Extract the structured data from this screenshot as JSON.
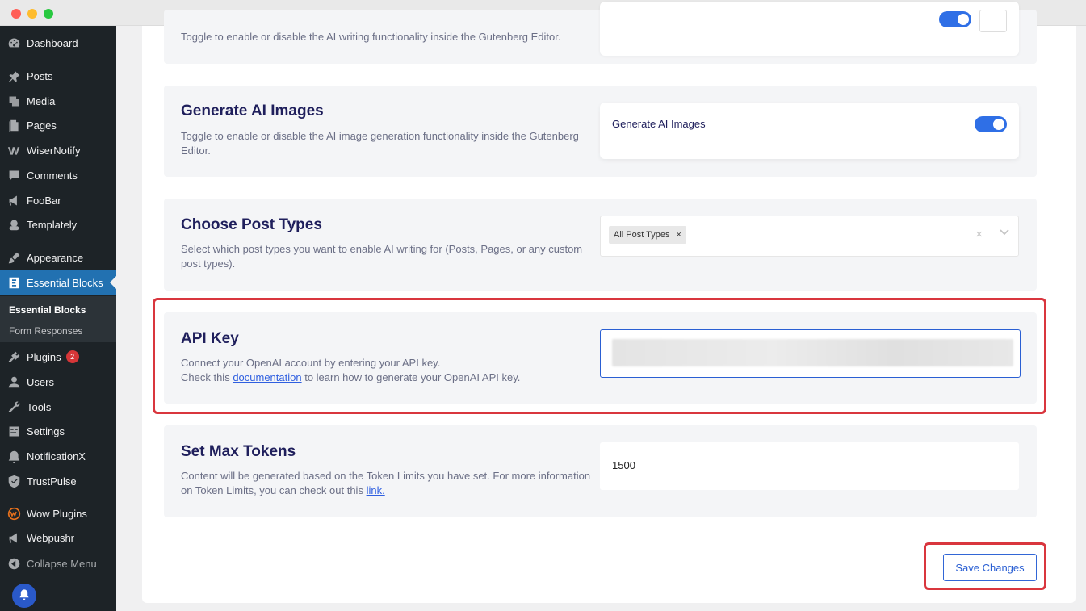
{
  "sidebar": {
    "items": [
      {
        "label": "Dashboard",
        "icon": "dashboard-icon"
      },
      {
        "label": "Posts",
        "icon": "pin-icon"
      },
      {
        "label": "Media",
        "icon": "media-icon"
      },
      {
        "label": "Pages",
        "icon": "pages-icon"
      },
      {
        "label": "WiserNotify",
        "icon": "wisernotify-icon"
      },
      {
        "label": "Comments",
        "icon": "comment-icon"
      },
      {
        "label": "FooBar",
        "icon": "megaphone-icon"
      },
      {
        "label": "Templately",
        "icon": "templately-icon"
      },
      {
        "label": "Appearance",
        "icon": "brush-icon"
      },
      {
        "label": "Essential Blocks",
        "icon": "essential-blocks-icon"
      },
      {
        "label": "Plugins",
        "icon": "plugin-icon",
        "badge": "2"
      },
      {
        "label": "Users",
        "icon": "user-icon"
      },
      {
        "label": "Tools",
        "icon": "wrench-icon"
      },
      {
        "label": "Settings",
        "icon": "settings-icon"
      },
      {
        "label": "NotificationX",
        "icon": "notificationx-icon"
      },
      {
        "label": "TrustPulse",
        "icon": "shield-check-icon"
      },
      {
        "label": "Wow Plugins",
        "icon": "wow-icon"
      },
      {
        "label": "Webpushr",
        "icon": "megaphone-icon"
      },
      {
        "label": "Collapse Menu",
        "icon": "collapse-icon"
      }
    ],
    "submenu": [
      {
        "label": "Essential Blocks"
      },
      {
        "label": "Form Responses"
      }
    ]
  },
  "sections": {
    "editor_partial": {
      "desc": "Toggle to enable or disable the AI writing functionality inside the Gutenberg Editor."
    },
    "images": {
      "title": "Generate AI Images",
      "desc": "Toggle to enable or disable the AI image generation functionality inside the Gutenberg Editor.",
      "toggle_label": "Generate AI Images",
      "toggle_on": true
    },
    "post_types": {
      "title": "Choose Post Types",
      "desc": "Select which post types you want to enable AI writing for (Posts, Pages, or any custom post types).",
      "tag": "All Post Types",
      "tag_remove": "×",
      "clear": "×"
    },
    "api_key": {
      "title": "API Key",
      "desc_line1": "Connect your OpenAI account by entering your API key.",
      "desc_pre": "Check this ",
      "desc_link": "documentation",
      "desc_post": " to learn how to generate your OpenAI API key."
    },
    "max_tokens": {
      "title": "Set Max Tokens",
      "desc_pre": "Content will be generated based on the Token Limits you have set. For more information on Token Limits, you can check out this ",
      "desc_link": "link.",
      "value": "1500"
    }
  },
  "actions": {
    "save_label": "Save Changes"
  },
  "colors": {
    "accent": "#2f6fe6",
    "highlight": "#d9363e",
    "sidebar_bg": "#1d2327",
    "active_menu": "#2271b1"
  }
}
